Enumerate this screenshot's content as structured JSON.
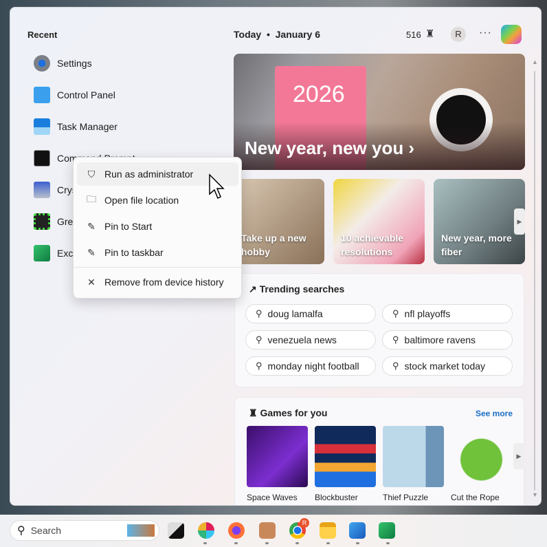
{
  "recent": {
    "title": "Recent",
    "apps": [
      {
        "label": "Settings",
        "icon": "settings-gear-icon",
        "color": "#6b7280"
      },
      {
        "label": "Control Panel",
        "icon": "control-panel-icon",
        "color": "#2b8ee8"
      },
      {
        "label": "Task Manager",
        "icon": "task-manager-icon",
        "color": "#1f8fe0"
      },
      {
        "label": "Command Prompt",
        "icon": "command-prompt-icon",
        "color": "#111111"
      },
      {
        "label": "Crys",
        "icon": "disk-info-icon",
        "color": "#3a5fc8"
      },
      {
        "label": "Gre",
        "icon": "green-app-icon",
        "color": "#222222"
      },
      {
        "label": "Exce",
        "icon": "excel-icon",
        "color": "#1e7a44"
      }
    ]
  },
  "context_menu": {
    "items": [
      {
        "label": "Run as administrator",
        "icon": "shield-icon"
      },
      {
        "label": "Open file location",
        "icon": "folder-icon"
      },
      {
        "label": "Pin to Start",
        "icon": "pin-icon"
      },
      {
        "label": "Pin to taskbar",
        "icon": "pin-icon"
      },
      {
        "label": "Remove from device history",
        "icon": "close-icon"
      }
    ]
  },
  "feed": {
    "header": "Today  •  January 6",
    "points": "516",
    "avatar_initial": "R",
    "more": "···",
    "hero": {
      "year": "2026",
      "title": "New year, new you ›"
    },
    "cards": [
      {
        "title": "Take up a new hobby"
      },
      {
        "title": "10 achievable resolutions"
      },
      {
        "title": "New year, more fiber"
      }
    ],
    "trending": {
      "title": "Trending searches",
      "items": [
        "doug lamalfa",
        "nfl playoffs",
        "venezuela news",
        "baltimore ravens",
        "monday night football",
        "stock market today"
      ]
    },
    "games": {
      "title": "Games for you",
      "see_more": "See more",
      "items": [
        "Space Waves",
        "Blockbuster",
        "Thief Puzzle",
        "Cut the Rope"
      ]
    }
  },
  "taskbar": {
    "search_placeholder": "Search",
    "apps": [
      "task-view",
      "slack",
      "firefox",
      "app",
      "chrome",
      "file-explorer",
      "word",
      "excel"
    ],
    "chrome_badge": "R"
  }
}
